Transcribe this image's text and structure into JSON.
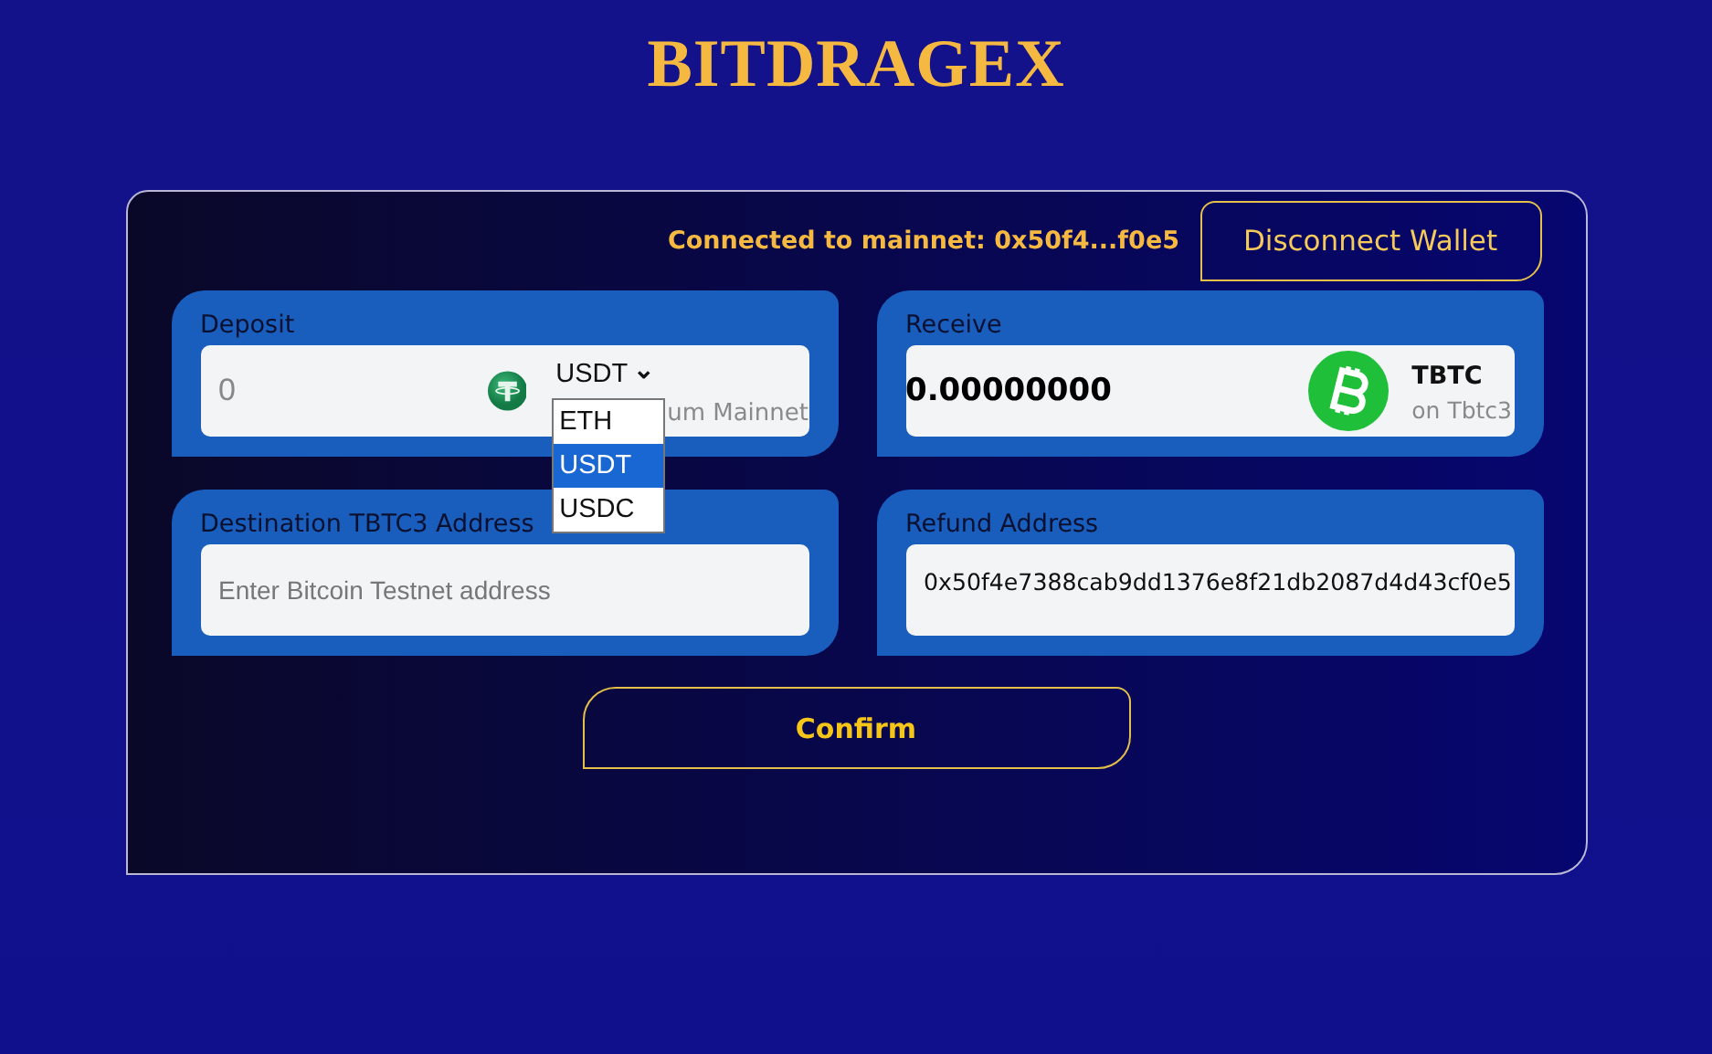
{
  "logo": "BITDRAGEX",
  "connection": {
    "status": "Connected to mainnet: 0x50f4...f0e5",
    "button": "Disconnect Wallet"
  },
  "deposit": {
    "label": "Deposit",
    "placeholder": "0",
    "token": "USDT",
    "caret": "⌄",
    "network": "um Mainnet",
    "options": [
      {
        "label": "ETH",
        "selected": false
      },
      {
        "label": "USDT",
        "selected": true
      },
      {
        "label": "USDC",
        "selected": false
      }
    ]
  },
  "receive": {
    "label": "Receive",
    "amount": "0.00000000",
    "token": "TBTC",
    "network": "on Tbtc3"
  },
  "destination": {
    "label": "Destination TBTC3 Address",
    "placeholder": "Enter Bitcoin Testnet address"
  },
  "refund": {
    "label": "Refund Address",
    "value": "0x50f4e7388cab9dd1376e8f21db2087d4d43cf0e5"
  },
  "confirm": "Confirm"
}
